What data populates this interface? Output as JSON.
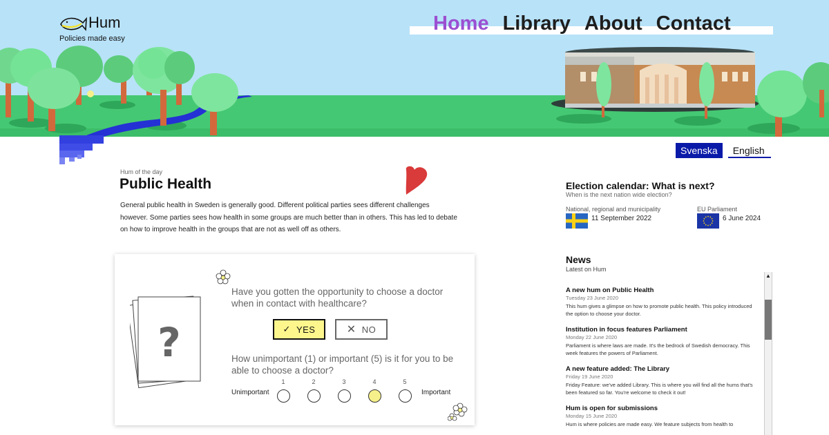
{
  "brand": {
    "name": "Hum",
    "tagline": "Policies made easy"
  },
  "nav": [
    {
      "label": "Home",
      "active": true
    },
    {
      "label": "Library",
      "active": false
    },
    {
      "label": "About",
      "active": false
    },
    {
      "label": "Contact",
      "active": false
    }
  ],
  "language": {
    "svenska": "Svenska",
    "english": "English",
    "selected": "Svenska"
  },
  "hum_of_day": {
    "label": "Hum of the day",
    "title": "Public Health",
    "description": "General public health in Sweden is generally good. Different political parties sees different challenges however. Some parties sees how health in some groups are much better than in others. This has led to debate on how to improve health in the groups that are not as well off as others."
  },
  "quiz": {
    "question1": "Have you gotten the opportunity to choose a doctor when in contact with healthcare?",
    "yes_label": "YES",
    "no_label": "NO",
    "yes_selected": true,
    "question2": "How unimportant (1) or important (5) is it for you to be able to choose a doctor?",
    "scale_low": "Unimportant",
    "scale_high": "Important",
    "scale": [
      "1",
      "2",
      "3",
      "4",
      "5"
    ],
    "selected_value": 4
  },
  "election": {
    "title": "Election calendar: What is next?",
    "subtitle": "When is the next nation wide election?",
    "items": [
      {
        "category": "National, regional and municipality",
        "date": "11 September 2022",
        "flag": "sweden-flag-icon"
      },
      {
        "category": "EU Parliament",
        "date": "6 June 2024",
        "flag": "eu-flag-icon"
      }
    ]
  },
  "news": {
    "title": "News",
    "subtitle": "Latest on Hum",
    "items": [
      {
        "title": "A new hum on Public Health",
        "date": "Tuesday 23 June 2020",
        "text": "This hum gives a glimpse on how to promote public health. This policy introduced the option to choose your doctor."
      },
      {
        "title": "Institution in focus features Parliament",
        "date": "Monday 22 June 2020",
        "text": "Parliament is where laws are made. It's the bedrock of Swedish democracy. This week features the powers of Parliament."
      },
      {
        "title": "A new feature added: The Library",
        "date": "Friday 19 June 2020",
        "text": "Friday Feature: we've added Library. This is where you will find all the hums that's been featured so far. You're welcome to check it out!"
      },
      {
        "title": "Hum is open for submissions",
        "date": "Monday 15 June 2020",
        "text": "Hum is where policies are made easy. We feature subjects from health to"
      }
    ]
  },
  "colors": {
    "accent": "#9b4fd1",
    "sky": "#b8e2f8",
    "grass": "#45c873",
    "navy": "#0a1aa8",
    "yes": "#fdf68c"
  }
}
